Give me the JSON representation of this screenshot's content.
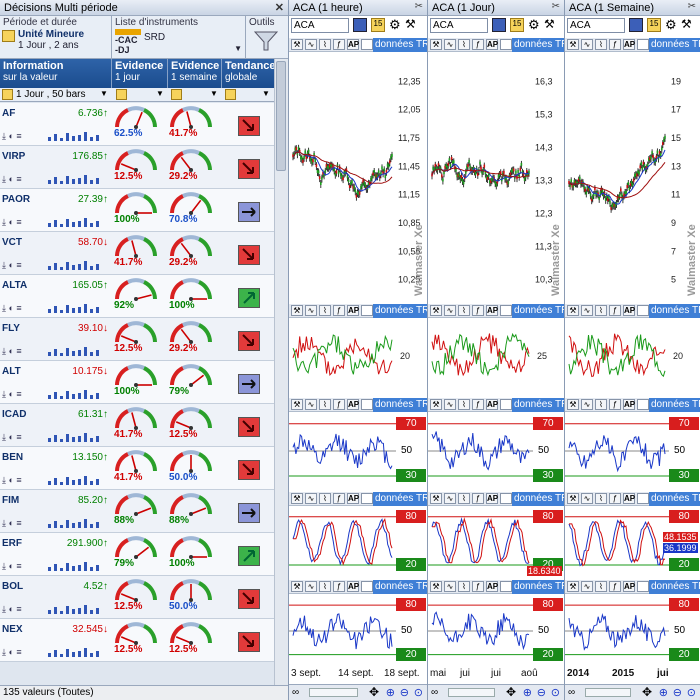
{
  "window": {
    "title": "Décisions Multi période"
  },
  "left": {
    "period_label": "Période et durée",
    "unit_label": "Unité Mineure",
    "unit_value": "1 Jour , 2 ans",
    "instruments_label": "Liste d'instruments",
    "instr_cac": "-CAC",
    "instr_dj": "-DJ",
    "instr_srd": "SRD",
    "tools_label": "Outils",
    "headers": [
      {
        "main": "Information",
        "sub": "sur la valeur"
      },
      {
        "main": "Evidence",
        "sub": "1 jour"
      },
      {
        "main": "Evidence",
        "sub": "1 semaine"
      },
      {
        "main": "Tendance",
        "sub": "globale"
      }
    ],
    "subhead_value": "1 Jour , 50 bars",
    "rows": [
      {
        "sym": "AF",
        "val": "6.736↑",
        "dir": "up",
        "g1": "62.5%",
        "g1c": "blue",
        "g1v": 0.625,
        "g2": "41.7%",
        "g2c": "red",
        "g2v": 0.417,
        "trend": "down"
      },
      {
        "sym": "VIRP",
        "val": "176.85↑",
        "dir": "up",
        "g1": "12.5%",
        "g1c": "red",
        "g1v": 0.125,
        "g2": "29.2%",
        "g2c": "red",
        "g2v": 0.292,
        "trend": "down"
      },
      {
        "sym": "PAOR",
        "val": "27.39↑",
        "dir": "up",
        "g1": "100%",
        "g1c": "green",
        "g1v": 1.0,
        "g2": "70.8%",
        "g2c": "blue",
        "g2v": 0.708,
        "trend": "flat"
      },
      {
        "sym": "VCT",
        "val": "58.70↓",
        "dir": "dn",
        "g1": "41.7%",
        "g1c": "red",
        "g1v": 0.417,
        "g2": "29.2%",
        "g2c": "red",
        "g2v": 0.292,
        "trend": "down"
      },
      {
        "sym": "ALTA",
        "val": "165.05↑",
        "dir": "up",
        "g1": "92%",
        "g1c": "green",
        "g1v": 0.92,
        "g2": "100%",
        "g2c": "green",
        "g2v": 1.0,
        "trend": "up"
      },
      {
        "sym": "FLY",
        "val": "39.10↓",
        "dir": "dn",
        "g1": "12.5%",
        "g1c": "red",
        "g1v": 0.125,
        "g2": "29.2%",
        "g2c": "red",
        "g2v": 0.292,
        "trend": "down"
      },
      {
        "sym": "ALT",
        "val": "10.175↓",
        "dir": "dn",
        "g1": "100%",
        "g1c": "green",
        "g1v": 1.0,
        "g2": "79%",
        "g2c": "green",
        "g2v": 0.79,
        "trend": "flat"
      },
      {
        "sym": "ICAD",
        "val": "61.31↑",
        "dir": "up",
        "g1": "41.7%",
        "g1c": "red",
        "g1v": 0.417,
        "g2": "12.5%",
        "g2c": "red",
        "g2v": 0.125,
        "trend": "down"
      },
      {
        "sym": "BEN",
        "val": "13.150↑",
        "dir": "up",
        "g1": "41.7%",
        "g1c": "red",
        "g1v": 0.417,
        "g2": "50.0%",
        "g2c": "blue",
        "g2v": 0.5,
        "trend": "down"
      },
      {
        "sym": "FIM",
        "val": "85.20↑",
        "dir": "up",
        "g1": "88%",
        "g1c": "green",
        "g1v": 0.88,
        "g2": "88%",
        "g2c": "green",
        "g2v": 0.88,
        "trend": "flat"
      },
      {
        "sym": "ERF",
        "val": "291.900↑",
        "dir": "up",
        "g1": "79%",
        "g1c": "green",
        "g1v": 0.79,
        "g2": "100%",
        "g2c": "green",
        "g2v": 1.0,
        "trend": "up"
      },
      {
        "sym": "BOL",
        "val": "4.52↑",
        "dir": "up",
        "g1": "12.5%",
        "g1c": "red",
        "g1v": 0.125,
        "g2": "50.0%",
        "g2c": "blue",
        "g2v": 0.5,
        "trend": "down"
      },
      {
        "sym": "NEX",
        "val": "32.545↓",
        "dir": "dn",
        "g1": "12.5%",
        "g1c": "red",
        "g1v": 0.125,
        "g2": "12.5%",
        "g2c": "red",
        "g2v": 0.125,
        "trend": "down"
      }
    ],
    "status": "135 valeurs (Toutes)"
  },
  "colors": {
    "up": "#008000",
    "down": "#d00000",
    "header_blue": "#1f4f92",
    "tag_blue": "#3f7fd6",
    "price_line": "#c00000",
    "ma_blue": "#1a38c8"
  },
  "panes": [
    {
      "title": "ACA (1 heure)",
      "symbol": "ACA",
      "tag": "données TR",
      "price_ticks": [
        "12,35",
        "12,05",
        "11,75",
        "11,45",
        "11,15",
        "10,85",
        "10,55",
        "10,25"
      ],
      "ind2_tick": "20",
      "ind3": {
        "top": "70",
        "mid": "50",
        "bot": "30"
      },
      "ind4": {
        "top": "80",
        "bot": "20"
      },
      "ind5": {
        "top": "80",
        "mid": "50",
        "bot": "20"
      },
      "xlabels": [
        "3 sept.",
        "14 sept.",
        "18 sept."
      ]
    },
    {
      "title": "ACA (1 Jour)",
      "symbol": "ACA",
      "tag": "données TR",
      "price_ticks": [
        "16,3",
        "15,3",
        "14,3",
        "13,3",
        "12,3",
        "11,3",
        "10,3"
      ],
      "ind2_tick": "25",
      "ind3": {
        "top": "70",
        "mid": "50",
        "bot": "30"
      },
      "ind4": {
        "top": "80",
        "bot": "20",
        "extra": "18.6340"
      },
      "ind5": {
        "top": "80",
        "mid": "50",
        "bot": "20"
      },
      "xlabels": [
        "mai",
        "jui",
        "jui",
        "aoû"
      ]
    },
    {
      "title": "ACA (1 Semaine)",
      "symbol": "ACA",
      "tag": "données TR",
      "price_ticks": [
        "19",
        "17",
        "15",
        "13",
        "11",
        "9",
        "7",
        "5"
      ],
      "ind2_tick": "20",
      "ind3": {
        "top": "70",
        "mid": "50",
        "bot": "30"
      },
      "ind4": {
        "top": "80",
        "val1": "48.1535",
        "val2": "36.1999",
        "bot": "20"
      },
      "ind5": {
        "top": "80",
        "mid": "50",
        "bot": "20"
      },
      "xlabels": [
        "2014",
        "2015",
        "jui"
      ]
    }
  ],
  "side_label": "Walmaster Xe"
}
